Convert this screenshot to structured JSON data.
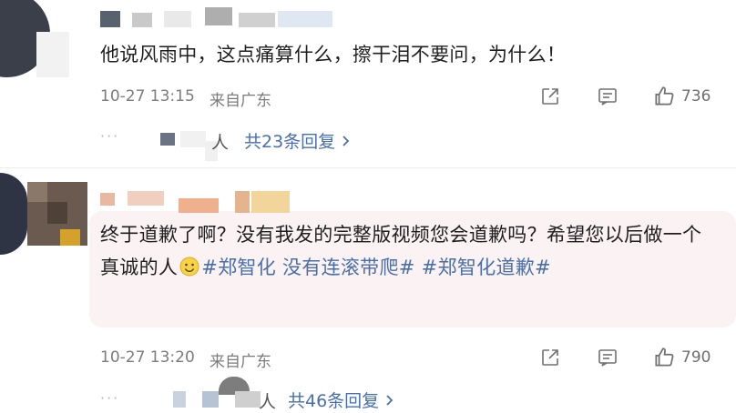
{
  "comments": [
    {
      "text": "他说风雨中，这点痛算什么，擦干泪不要问，为什么！",
      "time": "10-27 13:15",
      "source": "来自广东",
      "likes": "736",
      "reply_prefix": "人",
      "reply_label": "共23条回复"
    },
    {
      "text_plain": "终于道歉了啊？没有我发的完整版视频您会道歉吗？希望您以后做一个真诚的人",
      "hashtags": [
        "#郑智化 没有连滚带爬#",
        "#郑智化道歉#"
      ],
      "time": "10-27 13:20",
      "source": "来自广东",
      "likes": "790",
      "reply_prefix": "人",
      "reply_label": "共46条回复"
    }
  ],
  "icons": [
    "share-icon",
    "comment-icon",
    "like-icon",
    "chevron-right-icon",
    "smile-emoji-icon"
  ],
  "colors": {
    "link": "#4a6fa8",
    "meta": "#7c7c7c",
    "highlight": "#fbf2f4"
  }
}
